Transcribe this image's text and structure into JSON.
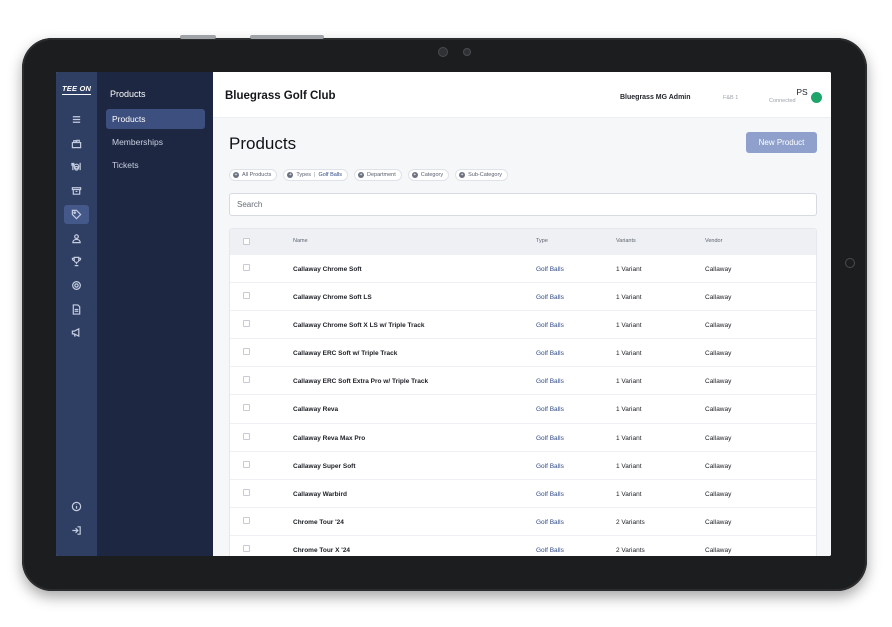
{
  "rail": {
    "logo": "TEE ON",
    "icons": [
      "menu-icon",
      "shop-icon",
      "dining-icon",
      "box-icon",
      "tag-icon",
      "user-icon",
      "trophy-icon",
      "settings-icon",
      "document-icon",
      "megaphone-icon",
      "info-icon",
      "logout-icon"
    ],
    "active": "tag-icon"
  },
  "subnav": {
    "title": "Products",
    "items": [
      {
        "label": "Products",
        "active": true
      },
      {
        "label": "Memberships",
        "active": false
      },
      {
        "label": "Tickets",
        "active": false
      }
    ]
  },
  "header": {
    "club": "Bluegrass Golf Club",
    "admin": "Bluegrass MG Admin",
    "station": "F&B 1",
    "initials": "PS",
    "status": "Connected",
    "status_color": "#1fa56a"
  },
  "page": {
    "title": "Products",
    "new_button": "New Product",
    "search_placeholder": "Search"
  },
  "filters": [
    {
      "label": "All Products",
      "value": ""
    },
    {
      "label": "Types",
      "value": "Golf Balls"
    },
    {
      "label": "Department",
      "value": ""
    },
    {
      "label": "Category",
      "value": ""
    },
    {
      "label": "Sub-Category",
      "value": ""
    }
  ],
  "table": {
    "columns": {
      "name": "Name",
      "type": "Type",
      "variants": "Variants",
      "vendor": "Vendor"
    },
    "rows": [
      {
        "name": "Callaway Chrome Soft",
        "type": "Golf Balls",
        "variants": "1 Variant",
        "vendor": "Callaway"
      },
      {
        "name": "Callaway Chrome Soft LS",
        "type": "Golf Balls",
        "variants": "1 Variant",
        "vendor": "Callaway"
      },
      {
        "name": "Callaway Chrome Soft X LS w/ Triple Track",
        "type": "Golf Balls",
        "variants": "1 Variant",
        "vendor": "Callaway"
      },
      {
        "name": "Callaway ERC Soft w/ Triple Track",
        "type": "Golf Balls",
        "variants": "1 Variant",
        "vendor": "Callaway"
      },
      {
        "name": "Callaway ERC Soft Extra Pro w/ Triple Track",
        "type": "Golf Balls",
        "variants": "1 Variant",
        "vendor": "Callaway"
      },
      {
        "name": "Callaway Reva",
        "type": "Golf Balls",
        "variants": "1 Variant",
        "vendor": "Callaway"
      },
      {
        "name": "Callaway Reva Max Pro",
        "type": "Golf Balls",
        "variants": "1 Variant",
        "vendor": "Callaway"
      },
      {
        "name": "Callaway Super Soft",
        "type": "Golf Balls",
        "variants": "1 Variant",
        "vendor": "Callaway"
      },
      {
        "name": "Callaway Warbird",
        "type": "Golf Balls",
        "variants": "1 Variant",
        "vendor": "Callaway"
      },
      {
        "name": "Chrome Tour '24",
        "type": "Golf Balls",
        "variants": "2 Variants",
        "vendor": "Callaway"
      },
      {
        "name": "Chrome Tour X '24",
        "type": "Golf Balls",
        "variants": "2 Variants",
        "vendor": "Callaway"
      }
    ]
  }
}
